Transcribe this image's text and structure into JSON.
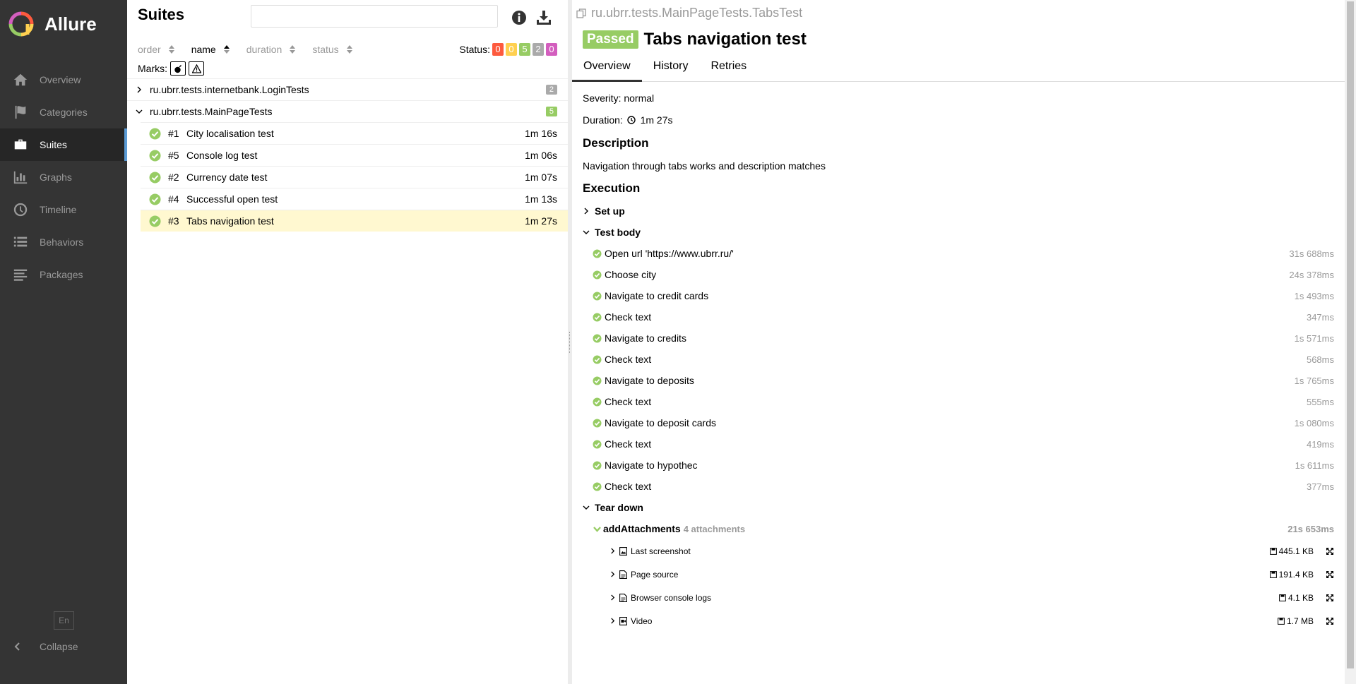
{
  "sidebar": {
    "brand": "Allure",
    "items": [
      {
        "label": "Overview",
        "icon": "home-icon"
      },
      {
        "label": "Categories",
        "icon": "flag-icon"
      },
      {
        "label": "Suites",
        "icon": "briefcase-icon",
        "active": true
      },
      {
        "label": "Graphs",
        "icon": "bar-chart-icon"
      },
      {
        "label": "Timeline",
        "icon": "clock-icon"
      },
      {
        "label": "Behaviors",
        "icon": "list-icon"
      },
      {
        "label": "Packages",
        "icon": "align-left-icon"
      }
    ],
    "lang": "En",
    "collapse": "Collapse"
  },
  "suites": {
    "title": "Suites",
    "search_value": "",
    "sort": [
      {
        "label": "order",
        "active": false
      },
      {
        "label": "name",
        "active": true
      },
      {
        "label": "duration",
        "active": false
      },
      {
        "label": "status",
        "active": false
      }
    ],
    "status_label": "Status:",
    "status_counts": [
      {
        "value": "0",
        "color": "#fd5a3e"
      },
      {
        "value": "0",
        "color": "#ffd050"
      },
      {
        "value": "5",
        "color": "#97cc64"
      },
      {
        "value": "2",
        "color": "#aaaaaa"
      },
      {
        "value": "0",
        "color": "#d35ebe"
      }
    ],
    "marks_label": "Marks:",
    "groups": [
      {
        "name": "ru.ubrr.tests.internetbank.LoginTests",
        "count": "2",
        "count_color": "#aaaaaa",
        "expanded": false,
        "tests": []
      },
      {
        "name": "ru.ubrr.tests.MainPageTests",
        "count": "5",
        "count_color": "#97cc64",
        "expanded": true,
        "tests": [
          {
            "num": "#1",
            "name": "City localisation test",
            "duration": "1m 16s"
          },
          {
            "num": "#5",
            "name": "Console log test",
            "duration": "1m 06s"
          },
          {
            "num": "#2",
            "name": "Currency date test",
            "duration": "1m 07s"
          },
          {
            "num": "#4",
            "name": "Successful open test",
            "duration": "1m 13s"
          },
          {
            "num": "#3",
            "name": "Tabs navigation test",
            "duration": "1m 27s",
            "selected": true
          }
        ]
      }
    ]
  },
  "detail": {
    "breadcrumb": "ru.ubrr.tests.MainPageTests.TabsTest",
    "status": "Passed",
    "title": "Tabs navigation test",
    "tabs": [
      "Overview",
      "History",
      "Retries"
    ],
    "severity": "Severity: normal",
    "duration_label": "Duration:",
    "duration": "1m 27s",
    "description_heading": "Description",
    "description": "Navigation through tabs works and description matches",
    "execution_heading": "Execution",
    "setup_label": "Set up",
    "body_label": "Test body",
    "steps": [
      {
        "name": "Open url 'https://www.ubrr.ru/'",
        "duration": "31s 688ms"
      },
      {
        "name": "Choose city",
        "duration": "24s 378ms"
      },
      {
        "name": "Navigate to credit cards",
        "duration": "1s 493ms"
      },
      {
        "name": "Check text",
        "duration": "347ms"
      },
      {
        "name": "Navigate to credits",
        "duration": "1s 571ms"
      },
      {
        "name": "Check text",
        "duration": "568ms"
      },
      {
        "name": "Navigate to deposits",
        "duration": "1s 765ms"
      },
      {
        "name": "Check text",
        "duration": "555ms"
      },
      {
        "name": "Navigate to deposit cards",
        "duration": "1s 080ms"
      },
      {
        "name": "Check text",
        "duration": "419ms"
      },
      {
        "name": "Navigate to hypothec",
        "duration": "1s 611ms"
      },
      {
        "name": "Check text",
        "duration": "377ms"
      }
    ],
    "teardown_label": "Tear down",
    "teardown_step": {
      "name": "addAttachments",
      "meta": "4 attachments",
      "duration": "21s 653ms"
    },
    "attachments": [
      {
        "name": "Last screenshot",
        "size": "445.1 KB",
        "icon": "image-file-icon"
      },
      {
        "name": "Page source",
        "size": "191.4 KB",
        "icon": "text-file-icon"
      },
      {
        "name": "Browser console logs",
        "size": "4.1 KB",
        "icon": "text-file-icon"
      },
      {
        "name": "Video",
        "size": "1.7 MB",
        "icon": "video-file-icon"
      }
    ]
  }
}
